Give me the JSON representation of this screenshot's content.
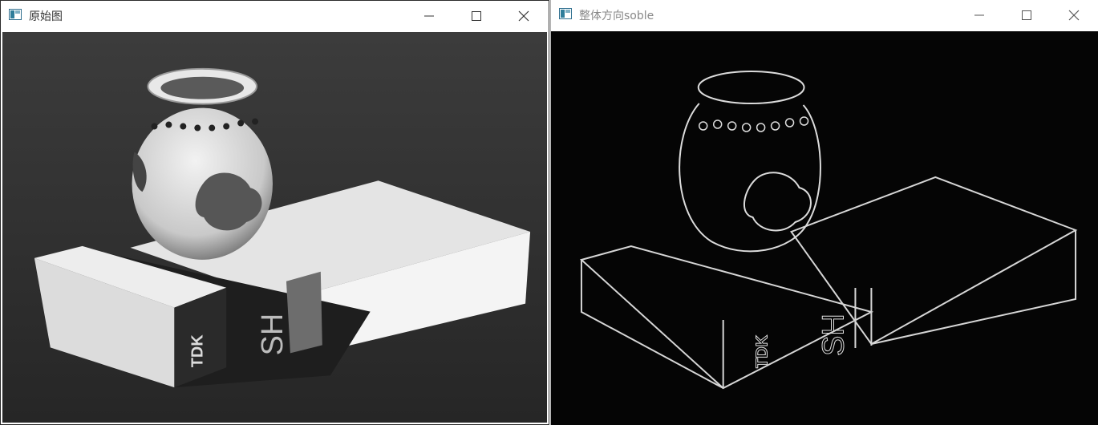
{
  "windows": [
    {
      "title": "原始图",
      "icon": "app-window-icon",
      "controls": [
        "minimize-icon",
        "maximize-icon",
        "close-icon"
      ]
    },
    {
      "title": "整体方向soble",
      "icon": "app-window-icon",
      "controls": [
        "minimize-icon",
        "maximize-icon",
        "close-icon"
      ]
    }
  ],
  "image_text": {
    "brand": "TDK",
    "label": "SH"
  },
  "colors": {
    "titlebar_bg": "#ffffff",
    "original_bg": "#2e2e2e",
    "edge_bg": "#050505",
    "edge_line": "#d8d8d8"
  }
}
